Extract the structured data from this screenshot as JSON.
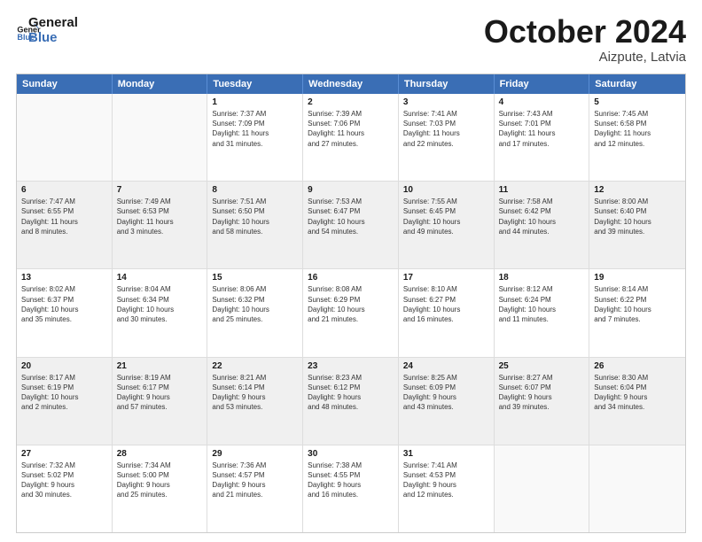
{
  "header": {
    "logo_line1": "General",
    "logo_line2": "Blue",
    "month": "October 2024",
    "location": "Aizpute, Latvia"
  },
  "weekdays": [
    "Sunday",
    "Monday",
    "Tuesday",
    "Wednesday",
    "Thursday",
    "Friday",
    "Saturday"
  ],
  "rows": [
    [
      {
        "day": "",
        "lines": []
      },
      {
        "day": "",
        "lines": []
      },
      {
        "day": "1",
        "lines": [
          "Sunrise: 7:37 AM",
          "Sunset: 7:09 PM",
          "Daylight: 11 hours",
          "and 31 minutes."
        ]
      },
      {
        "day": "2",
        "lines": [
          "Sunrise: 7:39 AM",
          "Sunset: 7:06 PM",
          "Daylight: 11 hours",
          "and 27 minutes."
        ]
      },
      {
        "day": "3",
        "lines": [
          "Sunrise: 7:41 AM",
          "Sunset: 7:03 PM",
          "Daylight: 11 hours",
          "and 22 minutes."
        ]
      },
      {
        "day": "4",
        "lines": [
          "Sunrise: 7:43 AM",
          "Sunset: 7:01 PM",
          "Daylight: 11 hours",
          "and 17 minutes."
        ]
      },
      {
        "day": "5",
        "lines": [
          "Sunrise: 7:45 AM",
          "Sunset: 6:58 PM",
          "Daylight: 11 hours",
          "and 12 minutes."
        ]
      }
    ],
    [
      {
        "day": "6",
        "lines": [
          "Sunrise: 7:47 AM",
          "Sunset: 6:55 PM",
          "Daylight: 11 hours",
          "and 8 minutes."
        ]
      },
      {
        "day": "7",
        "lines": [
          "Sunrise: 7:49 AM",
          "Sunset: 6:53 PM",
          "Daylight: 11 hours",
          "and 3 minutes."
        ]
      },
      {
        "day": "8",
        "lines": [
          "Sunrise: 7:51 AM",
          "Sunset: 6:50 PM",
          "Daylight: 10 hours",
          "and 58 minutes."
        ]
      },
      {
        "day": "9",
        "lines": [
          "Sunrise: 7:53 AM",
          "Sunset: 6:47 PM",
          "Daylight: 10 hours",
          "and 54 minutes."
        ]
      },
      {
        "day": "10",
        "lines": [
          "Sunrise: 7:55 AM",
          "Sunset: 6:45 PM",
          "Daylight: 10 hours",
          "and 49 minutes."
        ]
      },
      {
        "day": "11",
        "lines": [
          "Sunrise: 7:58 AM",
          "Sunset: 6:42 PM",
          "Daylight: 10 hours",
          "and 44 minutes."
        ]
      },
      {
        "day": "12",
        "lines": [
          "Sunrise: 8:00 AM",
          "Sunset: 6:40 PM",
          "Daylight: 10 hours",
          "and 39 minutes."
        ]
      }
    ],
    [
      {
        "day": "13",
        "lines": [
          "Sunrise: 8:02 AM",
          "Sunset: 6:37 PM",
          "Daylight: 10 hours",
          "and 35 minutes."
        ]
      },
      {
        "day": "14",
        "lines": [
          "Sunrise: 8:04 AM",
          "Sunset: 6:34 PM",
          "Daylight: 10 hours",
          "and 30 minutes."
        ]
      },
      {
        "day": "15",
        "lines": [
          "Sunrise: 8:06 AM",
          "Sunset: 6:32 PM",
          "Daylight: 10 hours",
          "and 25 minutes."
        ]
      },
      {
        "day": "16",
        "lines": [
          "Sunrise: 8:08 AM",
          "Sunset: 6:29 PM",
          "Daylight: 10 hours",
          "and 21 minutes."
        ]
      },
      {
        "day": "17",
        "lines": [
          "Sunrise: 8:10 AM",
          "Sunset: 6:27 PM",
          "Daylight: 10 hours",
          "and 16 minutes."
        ]
      },
      {
        "day": "18",
        "lines": [
          "Sunrise: 8:12 AM",
          "Sunset: 6:24 PM",
          "Daylight: 10 hours",
          "and 11 minutes."
        ]
      },
      {
        "day": "19",
        "lines": [
          "Sunrise: 8:14 AM",
          "Sunset: 6:22 PM",
          "Daylight: 10 hours",
          "and 7 minutes."
        ]
      }
    ],
    [
      {
        "day": "20",
        "lines": [
          "Sunrise: 8:17 AM",
          "Sunset: 6:19 PM",
          "Daylight: 10 hours",
          "and 2 minutes."
        ]
      },
      {
        "day": "21",
        "lines": [
          "Sunrise: 8:19 AM",
          "Sunset: 6:17 PM",
          "Daylight: 9 hours",
          "and 57 minutes."
        ]
      },
      {
        "day": "22",
        "lines": [
          "Sunrise: 8:21 AM",
          "Sunset: 6:14 PM",
          "Daylight: 9 hours",
          "and 53 minutes."
        ]
      },
      {
        "day": "23",
        "lines": [
          "Sunrise: 8:23 AM",
          "Sunset: 6:12 PM",
          "Daylight: 9 hours",
          "and 48 minutes."
        ]
      },
      {
        "day": "24",
        "lines": [
          "Sunrise: 8:25 AM",
          "Sunset: 6:09 PM",
          "Daylight: 9 hours",
          "and 43 minutes."
        ]
      },
      {
        "day": "25",
        "lines": [
          "Sunrise: 8:27 AM",
          "Sunset: 6:07 PM",
          "Daylight: 9 hours",
          "and 39 minutes."
        ]
      },
      {
        "day": "26",
        "lines": [
          "Sunrise: 8:30 AM",
          "Sunset: 6:04 PM",
          "Daylight: 9 hours",
          "and 34 minutes."
        ]
      }
    ],
    [
      {
        "day": "27",
        "lines": [
          "Sunrise: 7:32 AM",
          "Sunset: 5:02 PM",
          "Daylight: 9 hours",
          "and 30 minutes."
        ]
      },
      {
        "day": "28",
        "lines": [
          "Sunrise: 7:34 AM",
          "Sunset: 5:00 PM",
          "Daylight: 9 hours",
          "and 25 minutes."
        ]
      },
      {
        "day": "29",
        "lines": [
          "Sunrise: 7:36 AM",
          "Sunset: 4:57 PM",
          "Daylight: 9 hours",
          "and 21 minutes."
        ]
      },
      {
        "day": "30",
        "lines": [
          "Sunrise: 7:38 AM",
          "Sunset: 4:55 PM",
          "Daylight: 9 hours",
          "and 16 minutes."
        ]
      },
      {
        "day": "31",
        "lines": [
          "Sunrise: 7:41 AM",
          "Sunset: 4:53 PM",
          "Daylight: 9 hours",
          "and 12 minutes."
        ]
      },
      {
        "day": "",
        "lines": []
      },
      {
        "day": "",
        "lines": []
      }
    ]
  ]
}
